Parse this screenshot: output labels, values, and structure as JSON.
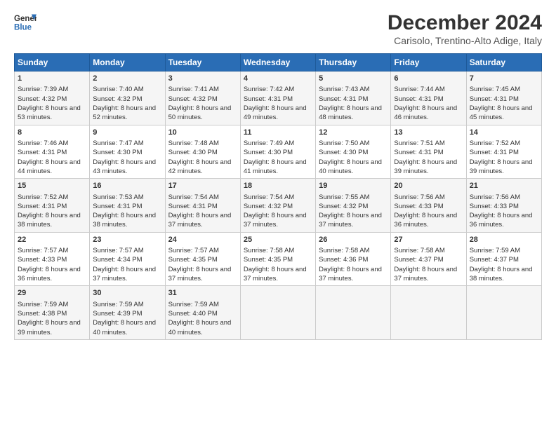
{
  "header": {
    "logo_line1": "General",
    "logo_line2": "Blue",
    "title": "December 2024",
    "subtitle": "Carisolo, Trentino-Alto Adige, Italy"
  },
  "days": [
    "Sunday",
    "Monday",
    "Tuesday",
    "Wednesday",
    "Thursday",
    "Friday",
    "Saturday"
  ],
  "weeks": [
    [
      {
        "day": "1",
        "rise": "Sunrise: 7:39 AM",
        "set": "Sunset: 4:32 PM",
        "daylight": "Daylight: 8 hours and 53 minutes."
      },
      {
        "day": "2",
        "rise": "Sunrise: 7:40 AM",
        "set": "Sunset: 4:32 PM",
        "daylight": "Daylight: 8 hours and 52 minutes."
      },
      {
        "day": "3",
        "rise": "Sunrise: 7:41 AM",
        "set": "Sunset: 4:32 PM",
        "daylight": "Daylight: 8 hours and 50 minutes."
      },
      {
        "day": "4",
        "rise": "Sunrise: 7:42 AM",
        "set": "Sunset: 4:31 PM",
        "daylight": "Daylight: 8 hours and 49 minutes."
      },
      {
        "day": "5",
        "rise": "Sunrise: 7:43 AM",
        "set": "Sunset: 4:31 PM",
        "daylight": "Daylight: 8 hours and 48 minutes."
      },
      {
        "day": "6",
        "rise": "Sunrise: 7:44 AM",
        "set": "Sunset: 4:31 PM",
        "daylight": "Daylight: 8 hours and 46 minutes."
      },
      {
        "day": "7",
        "rise": "Sunrise: 7:45 AM",
        "set": "Sunset: 4:31 PM",
        "daylight": "Daylight: 8 hours and 45 minutes."
      }
    ],
    [
      {
        "day": "8",
        "rise": "Sunrise: 7:46 AM",
        "set": "Sunset: 4:31 PM",
        "daylight": "Daylight: 8 hours and 44 minutes."
      },
      {
        "day": "9",
        "rise": "Sunrise: 7:47 AM",
        "set": "Sunset: 4:30 PM",
        "daylight": "Daylight: 8 hours and 43 minutes."
      },
      {
        "day": "10",
        "rise": "Sunrise: 7:48 AM",
        "set": "Sunset: 4:30 PM",
        "daylight": "Daylight: 8 hours and 42 minutes."
      },
      {
        "day": "11",
        "rise": "Sunrise: 7:49 AM",
        "set": "Sunset: 4:30 PM",
        "daylight": "Daylight: 8 hours and 41 minutes."
      },
      {
        "day": "12",
        "rise": "Sunrise: 7:50 AM",
        "set": "Sunset: 4:30 PM",
        "daylight": "Daylight: 8 hours and 40 minutes."
      },
      {
        "day": "13",
        "rise": "Sunrise: 7:51 AM",
        "set": "Sunset: 4:31 PM",
        "daylight": "Daylight: 8 hours and 39 minutes."
      },
      {
        "day": "14",
        "rise": "Sunrise: 7:52 AM",
        "set": "Sunset: 4:31 PM",
        "daylight": "Daylight: 8 hours and 39 minutes."
      }
    ],
    [
      {
        "day": "15",
        "rise": "Sunrise: 7:52 AM",
        "set": "Sunset: 4:31 PM",
        "daylight": "Daylight: 8 hours and 38 minutes."
      },
      {
        "day": "16",
        "rise": "Sunrise: 7:53 AM",
        "set": "Sunset: 4:31 PM",
        "daylight": "Daylight: 8 hours and 38 minutes."
      },
      {
        "day": "17",
        "rise": "Sunrise: 7:54 AM",
        "set": "Sunset: 4:31 PM",
        "daylight": "Daylight: 8 hours and 37 minutes."
      },
      {
        "day": "18",
        "rise": "Sunrise: 7:54 AM",
        "set": "Sunset: 4:32 PM",
        "daylight": "Daylight: 8 hours and 37 minutes."
      },
      {
        "day": "19",
        "rise": "Sunrise: 7:55 AM",
        "set": "Sunset: 4:32 PM",
        "daylight": "Daylight: 8 hours and 37 minutes."
      },
      {
        "day": "20",
        "rise": "Sunrise: 7:56 AM",
        "set": "Sunset: 4:33 PM",
        "daylight": "Daylight: 8 hours and 36 minutes."
      },
      {
        "day": "21",
        "rise": "Sunrise: 7:56 AM",
        "set": "Sunset: 4:33 PM",
        "daylight": "Daylight: 8 hours and 36 minutes."
      }
    ],
    [
      {
        "day": "22",
        "rise": "Sunrise: 7:57 AM",
        "set": "Sunset: 4:33 PM",
        "daylight": "Daylight: 8 hours and 36 minutes."
      },
      {
        "day": "23",
        "rise": "Sunrise: 7:57 AM",
        "set": "Sunset: 4:34 PM",
        "daylight": "Daylight: 8 hours and 37 minutes."
      },
      {
        "day": "24",
        "rise": "Sunrise: 7:57 AM",
        "set": "Sunset: 4:35 PM",
        "daylight": "Daylight: 8 hours and 37 minutes."
      },
      {
        "day": "25",
        "rise": "Sunrise: 7:58 AM",
        "set": "Sunset: 4:35 PM",
        "daylight": "Daylight: 8 hours and 37 minutes."
      },
      {
        "day": "26",
        "rise": "Sunrise: 7:58 AM",
        "set": "Sunset: 4:36 PM",
        "daylight": "Daylight: 8 hours and 37 minutes."
      },
      {
        "day": "27",
        "rise": "Sunrise: 7:58 AM",
        "set": "Sunset: 4:37 PM",
        "daylight": "Daylight: 8 hours and 37 minutes."
      },
      {
        "day": "28",
        "rise": "Sunrise: 7:59 AM",
        "set": "Sunset: 4:37 PM",
        "daylight": "Daylight: 8 hours and 38 minutes."
      }
    ],
    [
      {
        "day": "29",
        "rise": "Sunrise: 7:59 AM",
        "set": "Sunset: 4:38 PM",
        "daylight": "Daylight: 8 hours and 39 minutes."
      },
      {
        "day": "30",
        "rise": "Sunrise: 7:59 AM",
        "set": "Sunset: 4:39 PM",
        "daylight": "Daylight: 8 hours and 40 minutes."
      },
      {
        "day": "31",
        "rise": "Sunrise: 7:59 AM",
        "set": "Sunset: 4:40 PM",
        "daylight": "Daylight: 8 hours and 40 minutes."
      },
      null,
      null,
      null,
      null
    ]
  ]
}
